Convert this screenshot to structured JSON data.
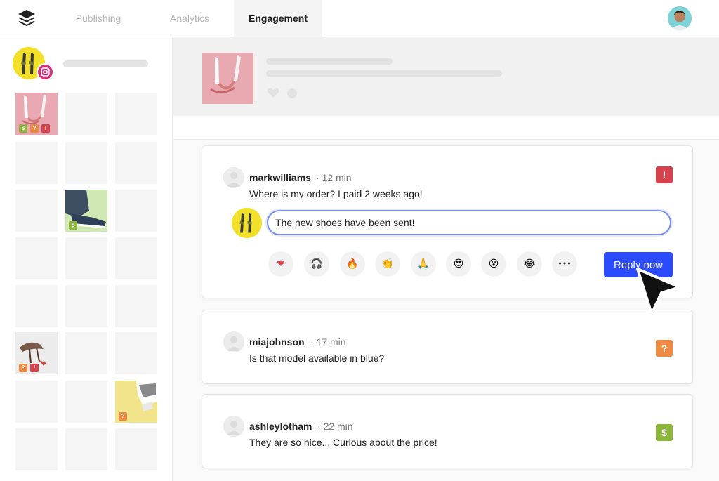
{
  "nav": {
    "tabs": [
      {
        "label": "Publishing",
        "active": false
      },
      {
        "label": "Analytics",
        "active": false
      },
      {
        "label": "Engagement",
        "active": true
      }
    ],
    "logo_icon": "buffer-stack-icon",
    "user_avatar_icon": "user-avatar"
  },
  "sidebar": {
    "account_network": "instagram",
    "tiles": [
      {
        "photo": "heels-pink",
        "badges": [
          "$",
          "?",
          "!"
        ]
      },
      {
        "photo": null,
        "badges": []
      },
      {
        "photo": null,
        "badges": []
      },
      {
        "photo": null,
        "badges": []
      },
      {
        "photo": null,
        "badges": []
      },
      {
        "photo": null,
        "badges": []
      },
      {
        "photo": null,
        "badges": []
      },
      {
        "photo": "sneakers-green",
        "badges": [
          "$"
        ]
      },
      {
        "photo": null,
        "badges": []
      },
      {
        "photo": "bird-shoes",
        "badges": [
          "?",
          "!"
        ]
      },
      {
        "photo": "yellow-stripes",
        "badges": [
          "?"
        ]
      }
    ]
  },
  "comments": [
    {
      "user": "markwilliams",
      "time": "12 min",
      "text": "Where is my order? I paid 2 weeks ago!",
      "flag": "!",
      "flag_color": "#d6424c",
      "reply": {
        "value": "The new shoes have been sent!",
        "emojis": [
          "❤",
          "🎧",
          "🔥",
          "👏",
          "🙏",
          "😍",
          "😮",
          "😂",
          "•••"
        ],
        "button_label": "Reply now"
      }
    },
    {
      "user": "miajohnson",
      "time": "17 min",
      "text": "Is that model available in blue?",
      "flag": "?",
      "flag_color": "#ef8a43"
    },
    {
      "user": "ashleylotham",
      "time": "22 min",
      "text": "They are so nice... Curious about the price!",
      "flag": "$",
      "flag_color": "#8bb63a"
    }
  ],
  "colors": {
    "accent": "#2c4bff",
    "input_border": "#7c8ff3",
    "flag_urgent": "#d6424c",
    "flag_question": "#ef8a43",
    "flag_sales": "#8bb63a"
  }
}
